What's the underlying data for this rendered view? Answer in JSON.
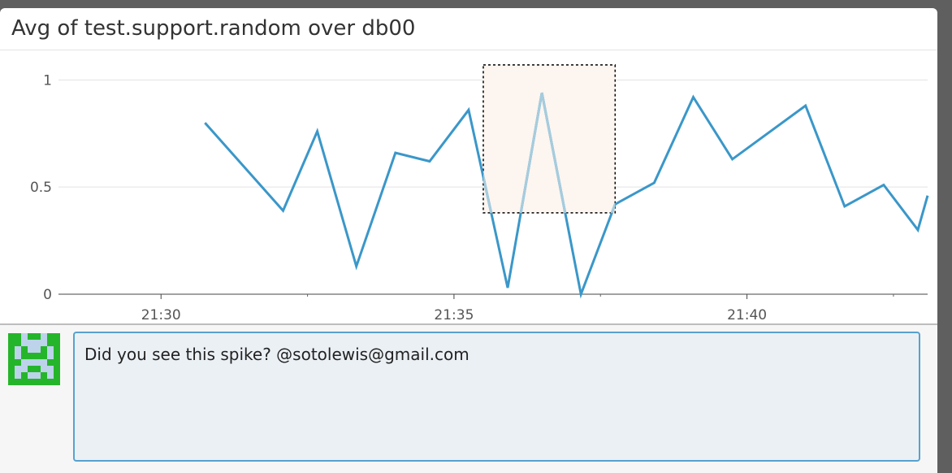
{
  "panel": {
    "title": "Avg of test.support.random over db00"
  },
  "chart_data": {
    "type": "line",
    "title": "Avg of test.support.random over db00",
    "xlabel": "",
    "ylabel": "",
    "ylim": [
      0,
      1.1
    ],
    "xlim": [
      "21:28:15",
      "21:43:05"
    ],
    "grid": true,
    "y_ticks": [
      {
        "value": 0,
        "label": "0"
      },
      {
        "value": 0.5,
        "label": "0.5"
      },
      {
        "value": 1,
        "label": "1"
      }
    ],
    "x_ticks": [
      {
        "time": "21:30",
        "label": "21:30"
      },
      {
        "time": "21:35",
        "label": "21:35"
      },
      {
        "time": "21:40",
        "label": "21:40"
      }
    ],
    "x_minor_ticks": [
      "21:32:30",
      "21:37:30",
      "21:42:30"
    ],
    "series": [
      {
        "color": "#3a97c9",
        "highlight_color": "#a6ccdd",
        "points": [
          {
            "x": "21:30:45",
            "y": 0.8
          },
          {
            "x": "21:32:05",
            "y": 0.39
          },
          {
            "x": "21:32:40",
            "y": 0.76
          },
          {
            "x": "21:33:20",
            "y": 0.13
          },
          {
            "x": "21:34:00",
            "y": 0.66
          },
          {
            "x": "21:34:35",
            "y": 0.62
          },
          {
            "x": "21:35:15",
            "y": 0.86
          },
          {
            "x": "21:35:55",
            "y": 0.03
          },
          {
            "x": "21:36:30",
            "y": 0.94
          },
          {
            "x": "21:37:10",
            "y": 0.0
          },
          {
            "x": "21:37:45",
            "y": 0.42
          },
          {
            "x": "21:38:25",
            "y": 0.52
          },
          {
            "x": "21:39:05",
            "y": 0.92
          },
          {
            "x": "21:39:45",
            "y": 0.63
          },
          {
            "x": "21:41:00",
            "y": 0.88
          },
          {
            "x": "21:41:40",
            "y": 0.41
          },
          {
            "x": "21:42:20",
            "y": 0.51
          },
          {
            "x": "21:42:55",
            "y": 0.3
          },
          {
            "x": "21:43:05",
            "y": 0.46
          }
        ]
      }
    ],
    "selection": {
      "x_range": [
        "21:35:30",
        "21:37:45"
      ],
      "y_range": [
        0.38,
        1.07
      ],
      "fill": "#fdf5f0"
    }
  },
  "comment": {
    "text": "Did you see this spike? @sotolewis@gmail.com"
  },
  "avatar": {
    "icon": "pixel-identicon",
    "fg": "#25b52a",
    "bg": "#bcd3ea"
  }
}
